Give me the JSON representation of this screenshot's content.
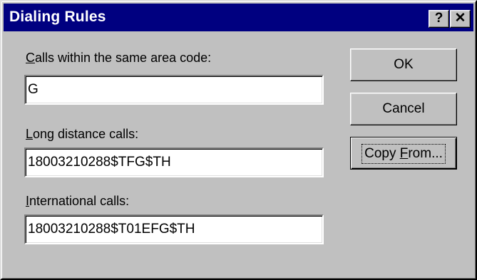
{
  "window": {
    "title": "Dialing Rules",
    "help_button": "?",
    "close_button": "✕"
  },
  "fields": {
    "local": {
      "label_prefix": "",
      "label_mnemonic": "C",
      "label_rest": "alls within the same area code:",
      "value": "G"
    },
    "long_distance": {
      "label_prefix": "",
      "label_mnemonic": "L",
      "label_rest": "ong distance calls:",
      "value": "18003210288$TFG$TH"
    },
    "international": {
      "label_prefix": "",
      "label_mnemonic": "I",
      "label_rest": "nternational calls:",
      "value": "18003210288$T01EFG$TH"
    }
  },
  "buttons": {
    "ok": "OK",
    "cancel": "Cancel",
    "copy_from_prefix": "Copy ",
    "copy_from_mnemonic": "F",
    "copy_from_rest": "rom..."
  }
}
